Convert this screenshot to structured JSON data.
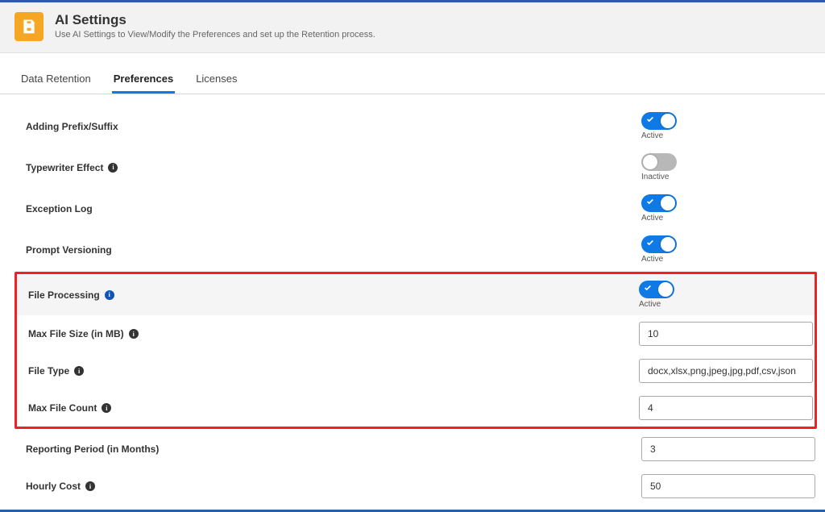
{
  "header": {
    "title": "AI Settings",
    "subtitle": "Use AI Settings to View/Modify the Preferences and set up the Retention process."
  },
  "tabs": {
    "data_retention": "Data Retention",
    "preferences": "Preferences",
    "licenses": "Licenses"
  },
  "status": {
    "active": "Active",
    "inactive": "Inactive"
  },
  "prefs": {
    "prefix_suffix": {
      "label": "Adding Prefix/Suffix",
      "state": "Active"
    },
    "typewriter": {
      "label": "Typewriter Effect",
      "state": "Inactive"
    },
    "exception_log": {
      "label": "Exception Log",
      "state": "Active"
    },
    "versioning": {
      "label": "Prompt Versioning",
      "state": "Active"
    },
    "file_processing": {
      "label": "File Processing",
      "state": "Active"
    },
    "max_file_size": {
      "label": "Max File Size (in MB)",
      "value": "10"
    },
    "file_type": {
      "label": "File Type",
      "value": "docx,xlsx,png,jpeg,jpg,pdf,csv,json"
    },
    "max_file_count": {
      "label": "Max File Count",
      "value": "4"
    },
    "reporting_period": {
      "label": "Reporting Period (in Months)",
      "value": "3"
    },
    "hourly_cost": {
      "label": "Hourly Cost",
      "value": "50"
    }
  }
}
